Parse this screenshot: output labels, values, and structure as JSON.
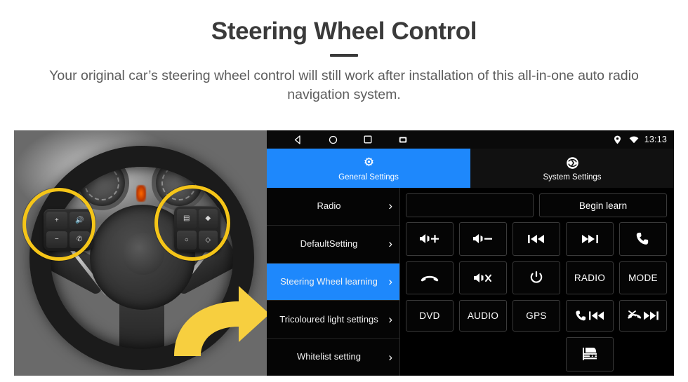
{
  "header": {
    "title": "Steering Wheel Control",
    "subtitle": "Your original car’s steering wheel control will still work after installation of this all-in-one auto radio navigation system."
  },
  "colors": {
    "accent_blue": "#1e88fc",
    "highlight_yellow": "#f5c518",
    "title_gray": "#3a3a3a",
    "subtitle_gray": "#5c5c5c",
    "ui_black": "#000000"
  },
  "photo": {
    "alt": "grayscale steering wheel with highlighted button clusters",
    "highlight_circles": 2,
    "arrow": "yellow-curved-arrow-right"
  },
  "android": {
    "statusbar": {
      "nav": [
        "back-icon",
        "home-icon",
        "recents-icon",
        "screenshot-icon"
      ],
      "location_icon": "location-pin-icon",
      "wifi_icon": "wifi-icon",
      "clock": "13:13"
    },
    "tabs": [
      {
        "label": "General Settings",
        "icon": "gear-icon",
        "active": true
      },
      {
        "label": "System Settings",
        "icon": "system-swirl-icon",
        "active": false
      }
    ],
    "menu": [
      {
        "label": "Radio",
        "selected": false
      },
      {
        "label": "DefaultSetting",
        "selected": false
      },
      {
        "label": "Steering Wheel learning",
        "selected": true
      },
      {
        "label": "Tricoloured light settings",
        "selected": false
      },
      {
        "label": "Whitelist setting",
        "selected": false
      }
    ],
    "menu_chevron": "›",
    "panel": {
      "display_value": "",
      "begin_learn_label": "Begin learn",
      "keys": [
        {
          "name": "volume-up-key",
          "label": "",
          "icon": "volume-plus-icon"
        },
        {
          "name": "volume-down-key",
          "label": "",
          "icon": "volume-minus-icon"
        },
        {
          "name": "previous-track-key",
          "label": "",
          "icon": "previous-track-icon"
        },
        {
          "name": "next-track-key",
          "label": "",
          "icon": "next-track-icon"
        },
        {
          "name": "answer-call-key",
          "label": "",
          "icon": "phone-answer-icon"
        },
        {
          "name": "hang-up-key",
          "label": "",
          "icon": "phone-hangup-icon"
        },
        {
          "name": "mute-key",
          "label": "",
          "icon": "volume-mute-icon"
        },
        {
          "name": "power-key",
          "label": "",
          "icon": "power-icon"
        },
        {
          "name": "radio-key",
          "label": "RADIO",
          "icon": ""
        },
        {
          "name": "mode-key",
          "label": "MODE",
          "icon": ""
        },
        {
          "name": "dvd-key",
          "label": "DVD",
          "icon": ""
        },
        {
          "name": "audio-key",
          "label": "AUDIO",
          "icon": ""
        },
        {
          "name": "gps-key",
          "label": "GPS",
          "icon": ""
        },
        {
          "name": "call-previous-key",
          "label": "",
          "icon": "phone-previous-icon"
        },
        {
          "name": "hangup-next-key",
          "label": "",
          "icon": "hangup-next-icon"
        },
        {
          "name": "car-info-key",
          "label": "",
          "icon": "car-rear-icon"
        }
      ]
    }
  }
}
